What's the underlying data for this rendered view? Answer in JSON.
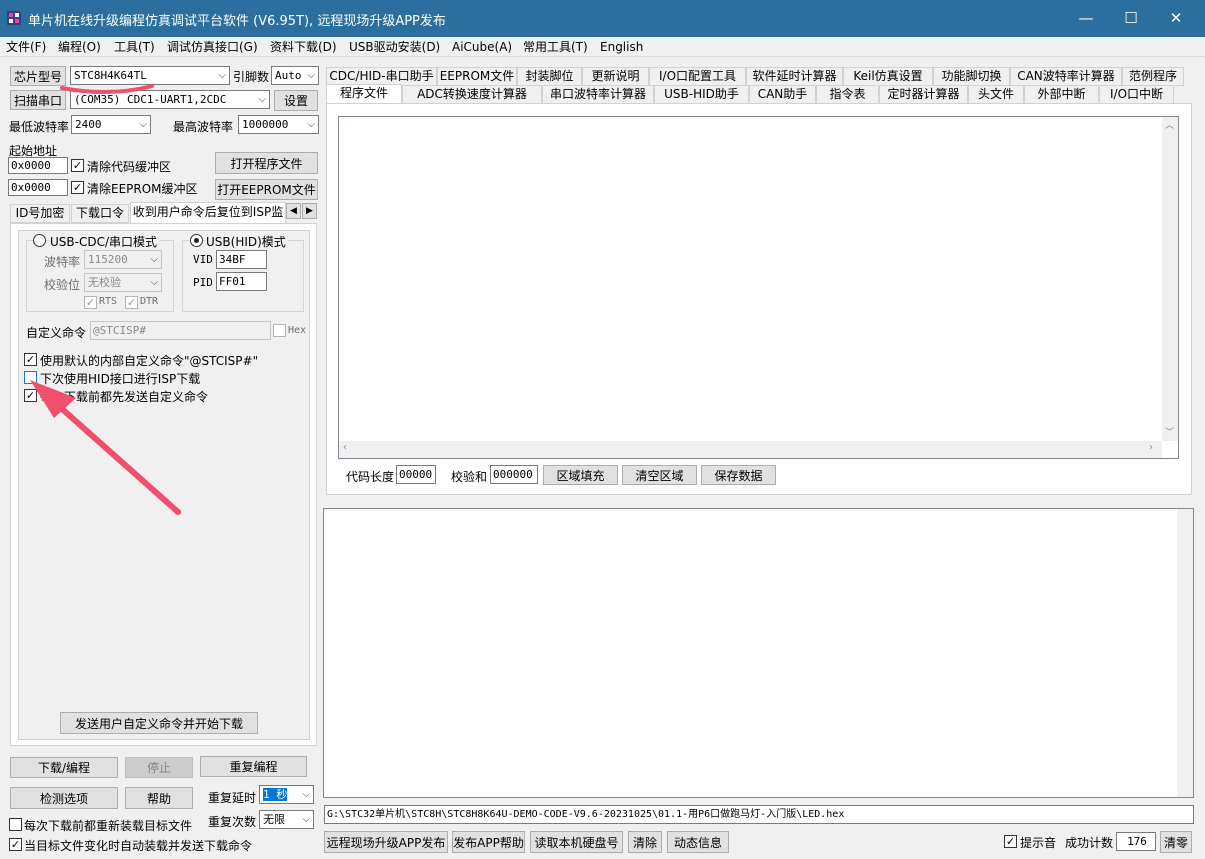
{
  "window": {
    "title": "单片机在线升级编程仿真调试平台软件 (V6.95T), 远程现场升级APP发布"
  },
  "menu": [
    "文件(F)",
    "编程(O)",
    "工具(T)",
    "调试仿真接口(G)",
    "资料下载(D)",
    "USB驱动安装(D)",
    "AiCube(A)",
    "常用工具(T)",
    "English"
  ],
  "left": {
    "chip_label": "芯片型号",
    "chip_value": "STC8H4K64TL",
    "pins_label": "引脚数",
    "pins_value": "Auto",
    "scan_label": "扫描串口",
    "port_value": "(COM35) CDC1-UART1,2CDC",
    "settings_label": "设置",
    "min_baud_label": "最低波特率",
    "min_baud_value": "2400",
    "max_baud_label": "最高波特率",
    "max_baud_value": "1000000",
    "start_addr_label": "起始地址",
    "addr1": "0x0000",
    "clear_code_label": "清除代码缓冲区",
    "open_prog_label": "打开程序文件",
    "addr2": "0x0000",
    "clear_eeprom_label": "清除EEPROM缓冲区",
    "open_eeprom_label": "打开EEPROM文件",
    "tabs": [
      "ID号加密",
      "下载口令",
      "收到用户命令后复位到ISP监"
    ],
    "usb_cdc_label": "USB-CDC/串口模式",
    "usb_hid_label": "USB(HID)模式",
    "baud_label": "波特率",
    "baud_value": "115200",
    "parity_label": "校验位",
    "parity_value": "无校验",
    "rts_label": "RTS",
    "dtr_label": "DTR",
    "vid_label": "VID",
    "vid_value": "34BF",
    "pid_label": "PID",
    "pid_value": "FF01",
    "custom_cmd_label": "自定义命令",
    "custom_cmd_value": "@STCISP#",
    "hex_label": "Hex",
    "opt1": "使用默认的内部自定义命令\"@STCISP#\"",
    "opt2": "下次使用HID接口进行ISP下载",
    "opt3": "每次下载前都先发送自定义命令",
    "send_btn": "发送用户自定义命令并开始下载",
    "download_btn": "下载/编程",
    "stop_btn": "停止",
    "reprogram_btn": "重复编程",
    "check_btn": "检测选项",
    "help_btn": "帮助",
    "repeat_delay_label": "重复延时",
    "repeat_delay_value": "1 秒",
    "repeat_count_label": "重复次数",
    "repeat_count_value": "无限",
    "reload_label": "每次下载前都重新装载目标文件",
    "auto_label": "当目标文件变化时自动装载并发送下载命令"
  },
  "right": {
    "tabs_row1": [
      "CDC/HID-串口助手",
      "EEPROM文件",
      "封装脚位",
      "更新说明",
      "I/O口配置工具",
      "软件延时计算器",
      "Keil仿真设置",
      "功能脚切换",
      "CAN波特率计算器",
      "范例程序"
    ],
    "tabs_row2": [
      "程序文件",
      "ADC转换速度计算器",
      "串口波特率计算器",
      "USB-HID助手",
      "CAN助手",
      "指令表",
      "定时器计算器",
      "头文件",
      "外部中断",
      "I/O口中断"
    ],
    "code_len_label": "代码长度",
    "code_len_value": "00000",
    "checksum_label": "校验和",
    "checksum_value": "000000",
    "fill_btn": "区域填充",
    "clear_btn": "清空区域",
    "save_btn": "保存数据",
    "path": "G:\\STC32单片机\\STC8H\\STC8H8K64U-DEMO-CODE-V9.6-20231025\\01.1-用P6口做跑马灯-入门版\\LED.hex",
    "remote_btn": "远程现场升级APP发布",
    "app_help_btn": "发布APP帮助",
    "read_disk_btn": "读取本机硬盘号",
    "clear_log_btn": "清除",
    "dynamic_btn": "动态信息",
    "beep_label": "提示音",
    "success_label": "成功计数",
    "success_value": "176",
    "reset_btn": "清零"
  },
  "colors": {
    "titlebar": "#2a6f9d",
    "annotation": "#f0506e"
  }
}
